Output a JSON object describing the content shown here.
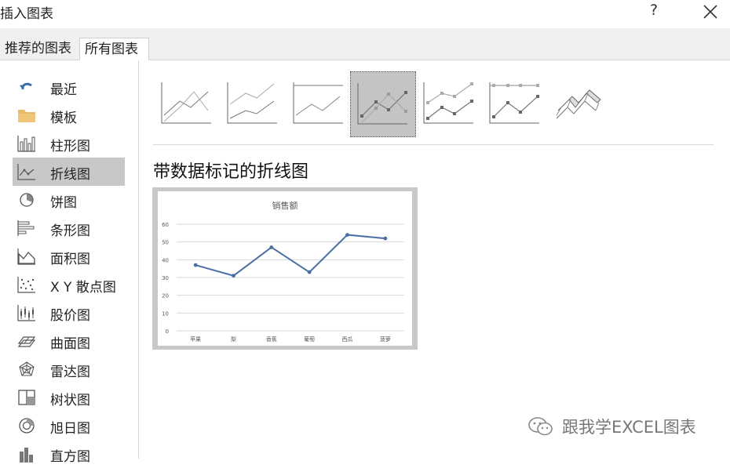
{
  "dialog": {
    "title": "插入图表",
    "help_label": "?"
  },
  "tabs": [
    {
      "label": "推荐的图表"
    },
    {
      "label": "所有图表"
    }
  ],
  "categories": [
    {
      "label": "最近",
      "icon": "recent-arrow-icon"
    },
    {
      "label": "模板",
      "icon": "folder-icon"
    },
    {
      "label": "柱形图",
      "icon": "column-chart-icon"
    },
    {
      "label": "折线图",
      "icon": "line-chart-icon"
    },
    {
      "label": "饼图",
      "icon": "pie-chart-icon"
    },
    {
      "label": "条形图",
      "icon": "bar-chart-icon"
    },
    {
      "label": "面积图",
      "icon": "area-chart-icon"
    },
    {
      "label": "X Y 散点图",
      "icon": "scatter-chart-icon"
    },
    {
      "label": "股价图",
      "icon": "stock-chart-icon"
    },
    {
      "label": "曲面图",
      "icon": "surface-chart-icon"
    },
    {
      "label": "雷达图",
      "icon": "radar-chart-icon"
    },
    {
      "label": "树状图",
      "icon": "treemap-chart-icon"
    },
    {
      "label": "旭日图",
      "icon": "sunburst-chart-icon"
    },
    {
      "label": "直方图",
      "icon": "histogram-chart-icon"
    }
  ],
  "selected_category": "折线图",
  "subtypes": [
    {
      "icon": "line-icon"
    },
    {
      "icon": "stacked-line-icon"
    },
    {
      "icon": "percent-stacked-line-icon"
    },
    {
      "icon": "line-with-markers-icon",
      "selected": true
    },
    {
      "icon": "stacked-line-with-markers-icon"
    },
    {
      "icon": "percent-stacked-line-with-markers-icon"
    },
    {
      "icon": "3d-line-icon"
    }
  ],
  "subtype_heading": "带数据标记的折线图",
  "chart_data": {
    "type": "line",
    "title": "销售额",
    "categories": [
      "苹果",
      "梨",
      "香蕉",
      "葡萄",
      "西瓜",
      "菠萝"
    ],
    "values": [
      37,
      31,
      47,
      33,
      54,
      52
    ],
    "ylim": [
      0,
      60
    ],
    "yticks": [
      0,
      10,
      20,
      30,
      40,
      50,
      60
    ],
    "grid": true,
    "color": "#4a6fa5"
  },
  "watermark": {
    "text": "跟我学EXCEL图表",
    "icon": "wechat-icon"
  }
}
